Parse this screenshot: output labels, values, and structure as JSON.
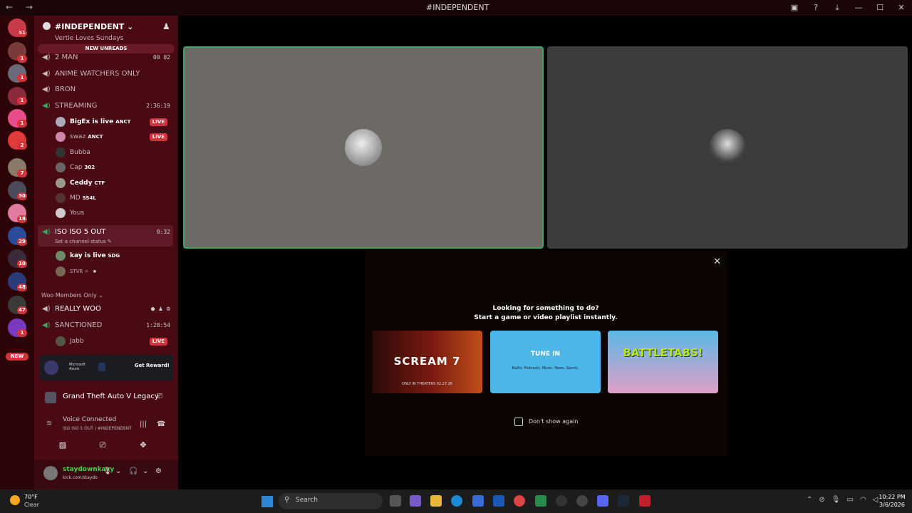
{
  "titlebar": {
    "back": "←",
    "forward": "→",
    "title": "#INDEPENDENT",
    "icons": [
      "inbox-icon",
      "help-icon",
      "download-icon"
    ],
    "min": "—",
    "max": "☐",
    "close": "✕"
  },
  "rail": {
    "badges": [
      "51",
      "1",
      "1",
      "1",
      "1",
      "1",
      "2",
      "7",
      "30",
      "18",
      "29",
      "10",
      "48",
      "47",
      "1"
    ],
    "new_label": "NEW"
  },
  "server": {
    "name": "#INDEPENDENT",
    "chevron": "⌄",
    "invite": "♟"
  },
  "new_unreads": "NEW UNREADS",
  "channels": [
    {
      "name": "Vertie Loves Sundays",
      "time": ""
    },
    {
      "name": "2 MAN",
      "time": "00 02"
    },
    {
      "name": "ANIME WATCHERS ONLY",
      "time": ""
    },
    {
      "name": "BRON",
      "time": ""
    },
    {
      "name": "STREAMING",
      "time": "2:36:19"
    },
    {
      "name": "ISO ISO 5 OUT",
      "time": "0:32"
    },
    {
      "name": "REALLY WOO",
      "time": ""
    },
    {
      "name": "SANCTIONED",
      "time": "1:28:54"
    }
  ],
  "streaming_members": [
    {
      "name": "BigEx is live",
      "tag": "ANCT",
      "live": "LIVE"
    },
    {
      "name": "swaz",
      "tag": "ANCT",
      "live": "LIVE"
    },
    {
      "name": "Bubba",
      "tag": "",
      "live": ""
    },
    {
      "name": "Cap",
      "tag": "302",
      "live": ""
    },
    {
      "name": "Ceddy",
      "tag": "CTF",
      "live": ""
    },
    {
      "name": "MD",
      "tag": "SS4L",
      "live": ""
    },
    {
      "name": "Yous",
      "tag": "",
      "live": ""
    }
  ],
  "iso_status": "Set a channel status",
  "iso_members": [
    {
      "name": "kay is live",
      "tag": "SDG"
    },
    {
      "name": "STVR ✧",
      "tag": "★"
    }
  ],
  "category": "Woo Members Only",
  "sanctioned_member": {
    "name": "Jabb",
    "live": "LIVE"
  },
  "promo": {
    "brand1": "Microsoft Azure",
    "cta": "Get Reward!"
  },
  "game": {
    "name": "Grand Theft Auto V Legacy"
  },
  "voice": {
    "title": "Voice Connected",
    "sub": "ISO ISO 5 OUT / #INDEPENDENT"
  },
  "user": {
    "name": "staydownkayy",
    "status": "kick.com/staydo"
  },
  "activity": {
    "close": "✕",
    "line1": "Looking for something to do?",
    "line2": "Start a game or video playlist instantly.",
    "cards": [
      {
        "title": "SCREAM 7",
        "sub": "ONLY IN THEATERS 02.27.26"
      },
      {
        "title": "TUNE IN",
        "sub": "Radio. Podcasts. Music. News. Sports."
      },
      {
        "title": "BATTLETABS!",
        "sub": ""
      }
    ],
    "checkbox_label": "Don't show again"
  },
  "taskbar": {
    "temp": "70°F",
    "weather": "Clear",
    "search": "Search",
    "time": "10:22 PM",
    "date": "3/6/2026"
  }
}
